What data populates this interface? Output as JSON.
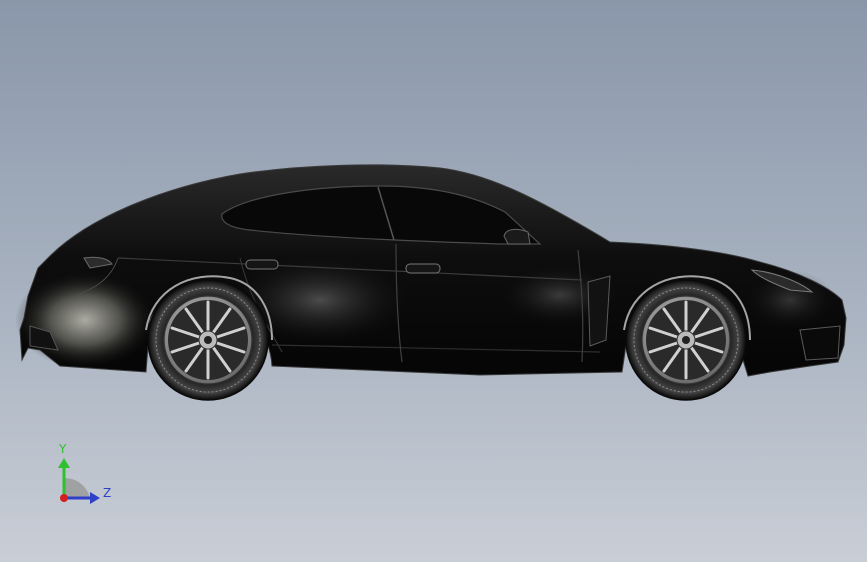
{
  "viewport": {
    "background_top": "#8a97aa",
    "background_bottom": "#c9ced6",
    "model": "car-side-view"
  },
  "triad": {
    "labels": {
      "y": "Y",
      "z": "Z"
    },
    "colors": {
      "x": "#d42020",
      "y": "#2ec02e",
      "z": "#2f3fc8"
    }
  }
}
